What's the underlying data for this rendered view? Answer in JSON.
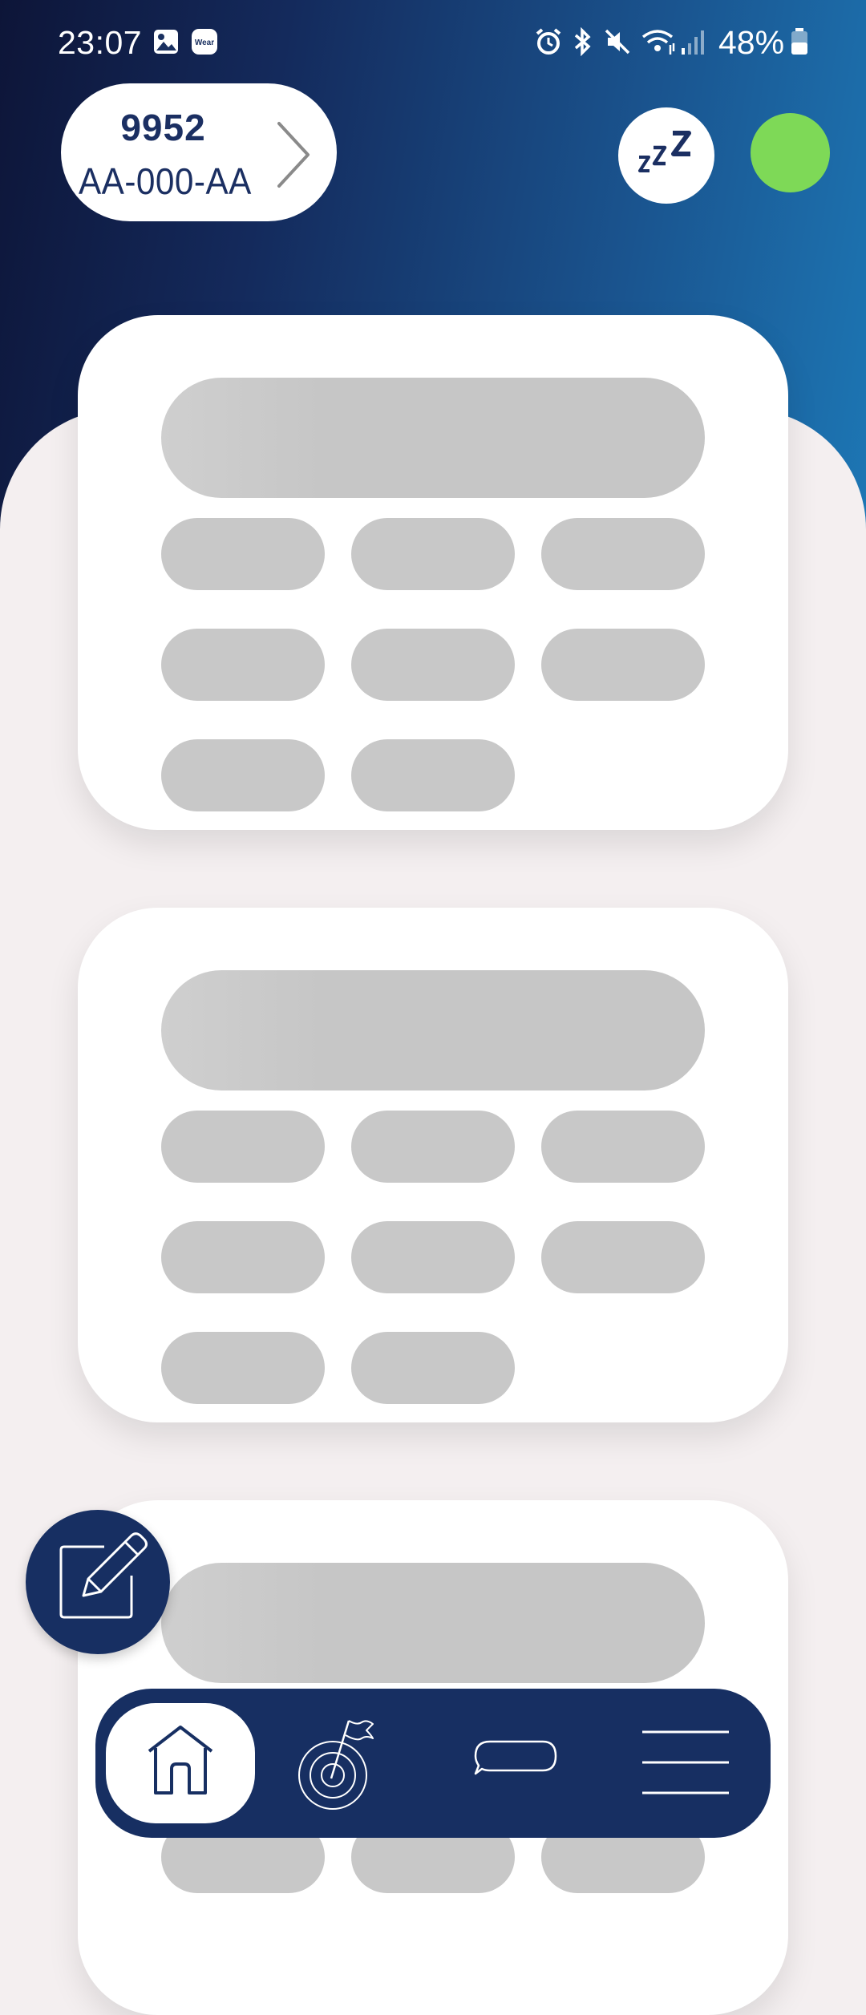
{
  "status_bar": {
    "time": "23:07",
    "battery": "48%",
    "icons": [
      "gallery-icon",
      "wear-icon",
      "alarm-icon",
      "bluetooth-icon",
      "mute-icon",
      "wifi-icon",
      "signal-icon",
      "battery-icon"
    ],
    "wear_label": "Wear"
  },
  "vehicle": {
    "id": "9952",
    "plate": "AA-000-AA"
  },
  "header": {
    "sleep_icon": "zzz-icon",
    "status_color": "#7ed957"
  },
  "theme": {
    "primary": "#172f62",
    "skeleton": "#c8c8c8",
    "background": "#f4eff0"
  },
  "bottom_nav": {
    "items": [
      "home-icon",
      "target-flag-icon",
      "chat-icon",
      "menu-icon"
    ],
    "active": "home-icon"
  }
}
